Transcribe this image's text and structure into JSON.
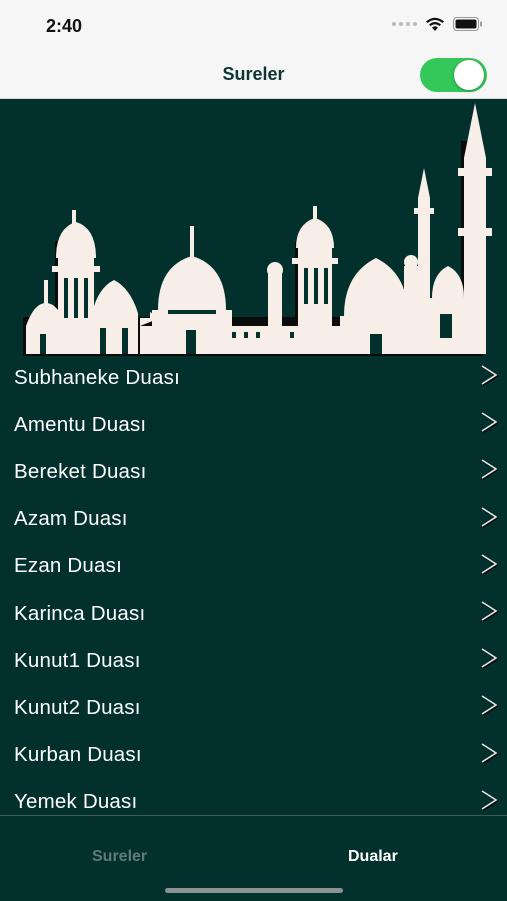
{
  "status": {
    "time": "2:40"
  },
  "nav": {
    "title": "Sureler",
    "toggle_on": true
  },
  "list": {
    "items": [
      {
        "label": "Subhaneke Duası"
      },
      {
        "label": "Amentu Duası"
      },
      {
        "label": "Bereket Duası"
      },
      {
        "label": "Azam Duası"
      },
      {
        "label": "Ezan Duası"
      },
      {
        "label": "Karinca Duası"
      },
      {
        "label": "Kunut1 Duası"
      },
      {
        "label": "Kunut2 Duası"
      },
      {
        "label": "Kurban Duası"
      },
      {
        "label": "Yemek Duası"
      }
    ],
    "chevron_icon": "chevron-right-icon"
  },
  "tabs": {
    "sureler": "Sureler",
    "dualar": "Dualar",
    "active": "Dualar"
  },
  "colors": {
    "background": "#02302d",
    "toggle": "#34c759",
    "mosque": "#f7eee8"
  }
}
